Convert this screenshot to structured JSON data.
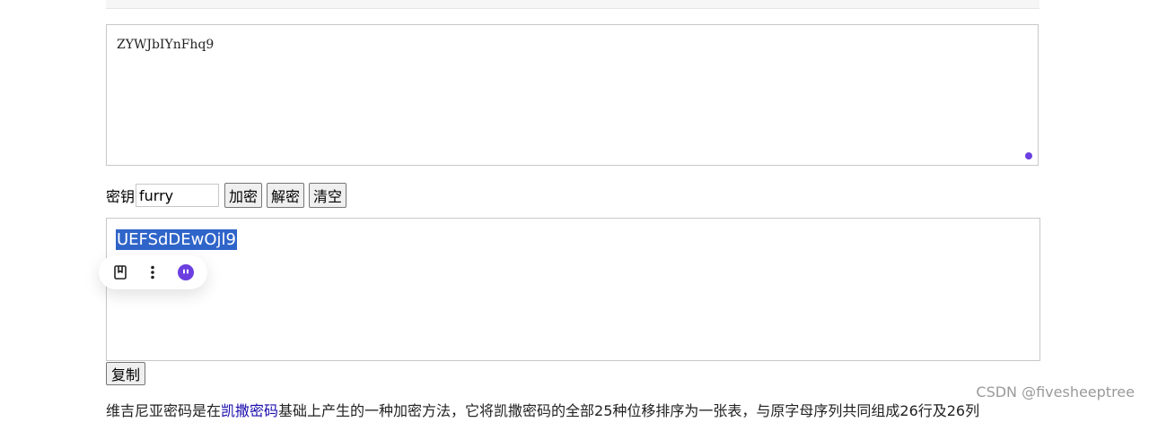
{
  "input": {
    "text": "ZYWJbIYnFhq9"
  },
  "controls": {
    "key_label": "密钥",
    "key_value": "furry",
    "encrypt_label": "加密",
    "decrypt_label": "解密",
    "clear_label": "清空"
  },
  "output": {
    "text": "UEFSdDEwOjl9"
  },
  "floating_toolbar": {
    "icons": [
      "bookmark-icon",
      "more-vert-icon",
      "assistant-icon"
    ]
  },
  "copy_label": "复制",
  "paragraph": {
    "before": "维吉尼亚密码是在",
    "link": "凯撒密码",
    "after": "基础上产生的一种加密方法，它将凯撒密码的全部25种位移排序为一张表，与原字母序列共同组成26行及26列"
  },
  "watermark": "CSDN @fivesheeptree",
  "colors": {
    "selection": "#2f64c9",
    "accent": "#6b3fe0"
  }
}
